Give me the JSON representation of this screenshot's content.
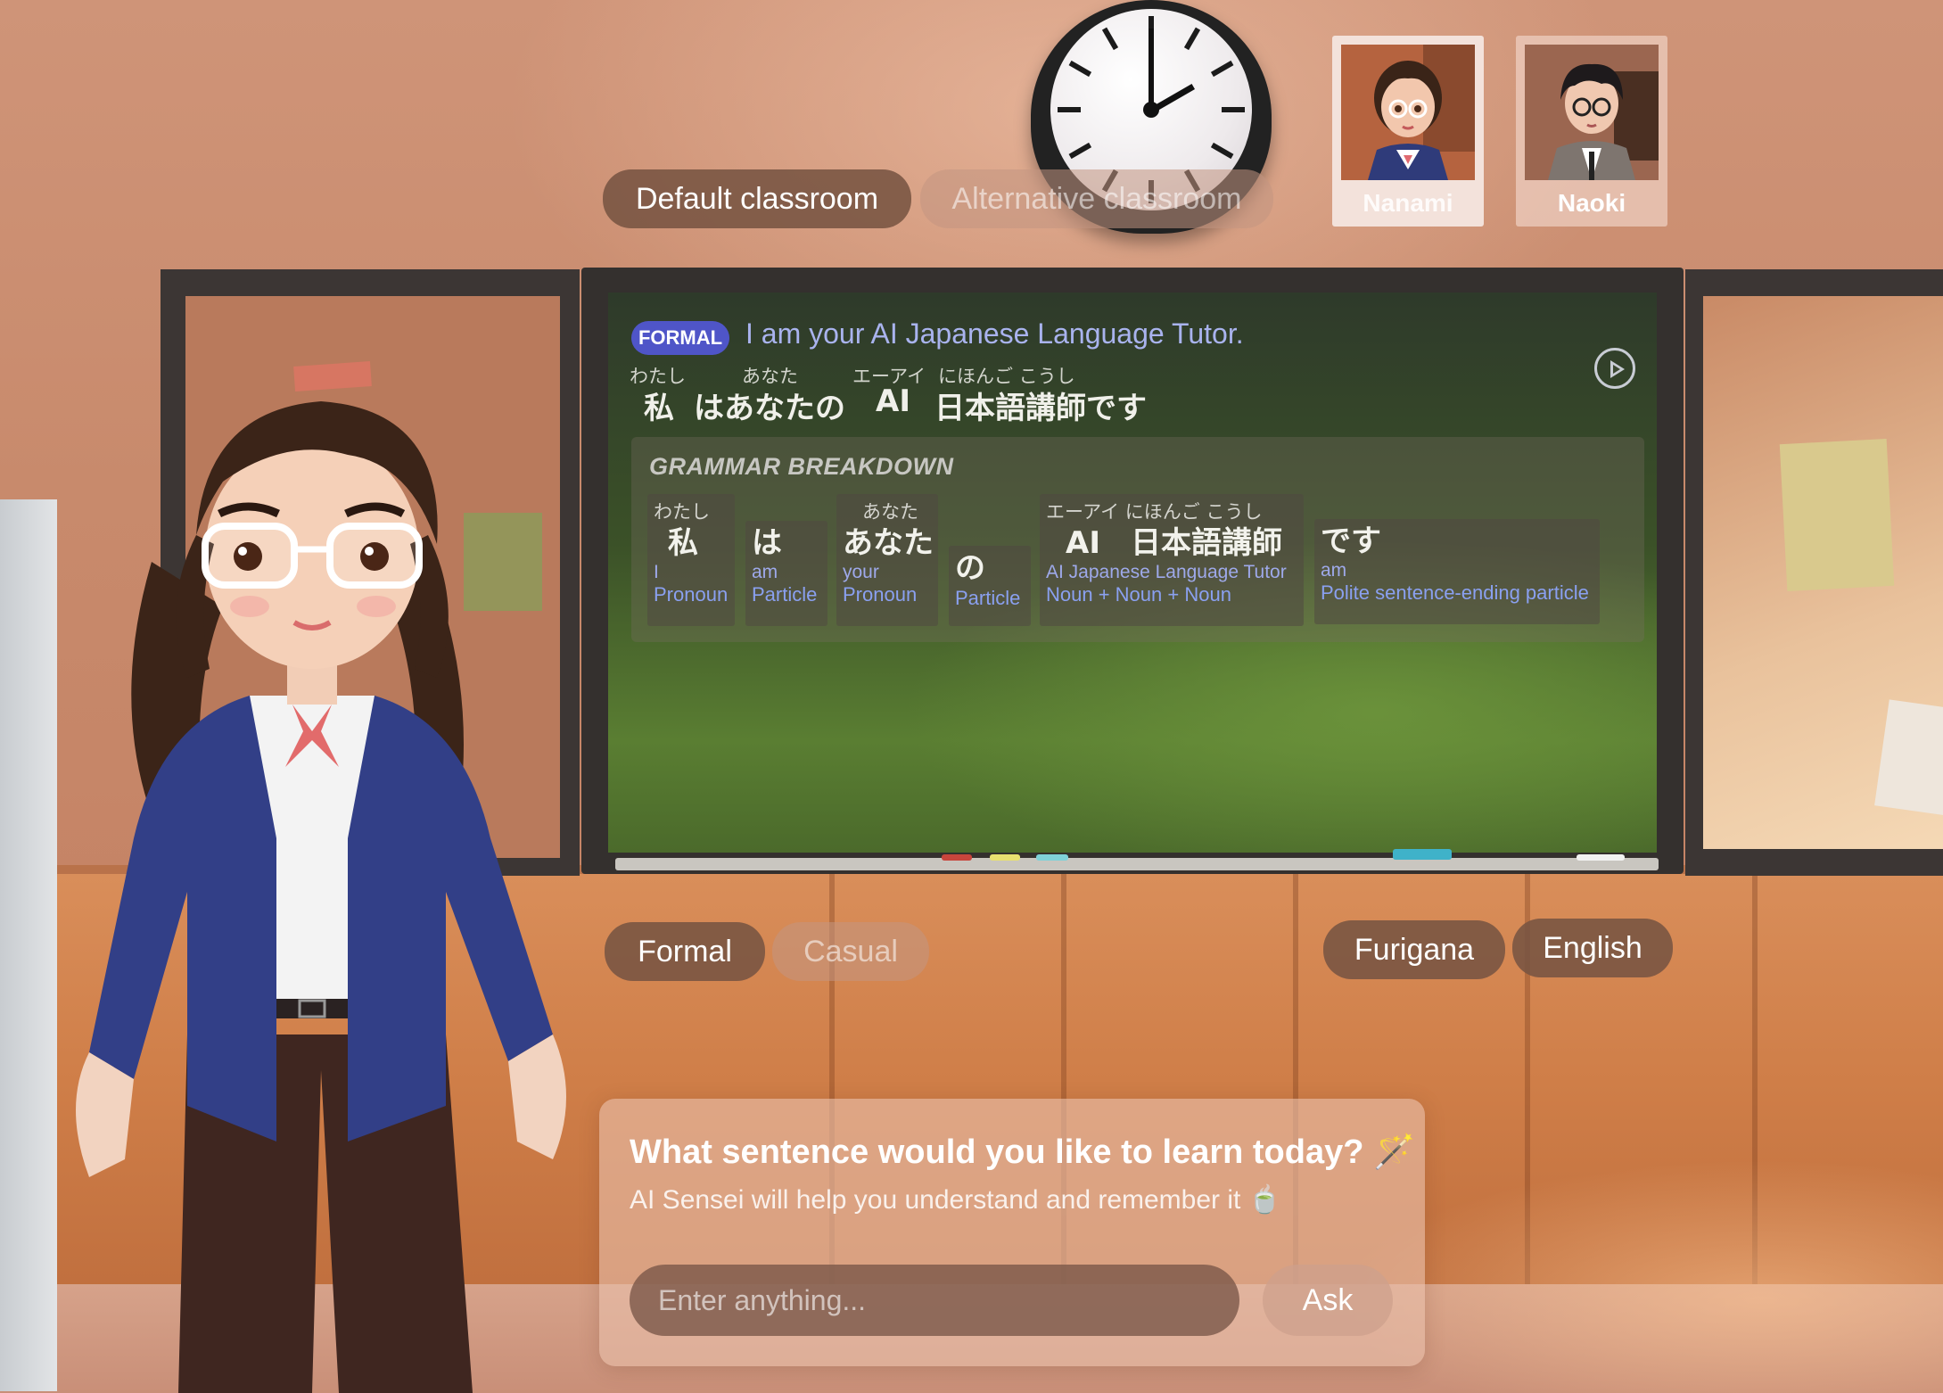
{
  "scene": {
    "classroom_tabs": [
      {
        "label": "Default classroom",
        "active": true
      },
      {
        "label": "Alternative classroom",
        "active": false
      }
    ],
    "tutors": [
      {
        "name": "Nanami",
        "selected": true
      },
      {
        "name": "Naoki",
        "selected": false
      }
    ]
  },
  "board": {
    "badge": "FORMAL",
    "english": "I am your AI Japanese Language Tutor.",
    "play_icon": "play-circle-icon",
    "sentence": [
      {
        "furigana": "わたし",
        "text": "私"
      },
      {
        "furigana": "",
        "text": "はあなたの"
      },
      {
        "furigana": "あなた",
        "text": ""
      },
      {
        "furigana": "エーアイ",
        "text": "AI"
      },
      {
        "furigana": "にほんご こうし",
        "text": "日本語講師です"
      }
    ],
    "grammar": {
      "title": "GRAMMAR BREAKDOWN",
      "tokens": [
        {
          "furigana": "わたし",
          "jp": "私",
          "english": "I",
          "pos": "Pronoun"
        },
        {
          "furigana": "",
          "jp": "は",
          "english": "am",
          "pos": "Particle"
        },
        {
          "furigana": "あなた",
          "jp": "あなた",
          "english": "your",
          "pos": "Pronoun"
        },
        {
          "furigana": "",
          "jp": "の",
          "english": "",
          "pos": "Particle"
        },
        {
          "furigana": "エーアイ にほんご こうし",
          "jp": "AI　日本語講師",
          "english": "AI Japanese Language Tutor",
          "pos": "Noun + Noun + Noun"
        },
        {
          "furigana": "",
          "jp": "です",
          "english": "am",
          "pos": "Polite sentence-ending particle"
        }
      ]
    }
  },
  "style_toggle": [
    {
      "label": "Formal",
      "active": true
    },
    {
      "label": "Casual",
      "active": false
    }
  ],
  "display_toggles": [
    {
      "label": "Furigana"
    },
    {
      "label": "English"
    }
  ],
  "ask": {
    "title": "What sentence would you like to learn today? 🪄",
    "subtitle": "AI Sensei will help you understand and remember it 🍵",
    "placeholder": "Enter anything...",
    "button": "Ask"
  },
  "colors": {
    "badge": "#4f55c8",
    "english_text": "#a9b3ee",
    "pos_text": "#8aa0f0",
    "pill_active": "#785442"
  }
}
